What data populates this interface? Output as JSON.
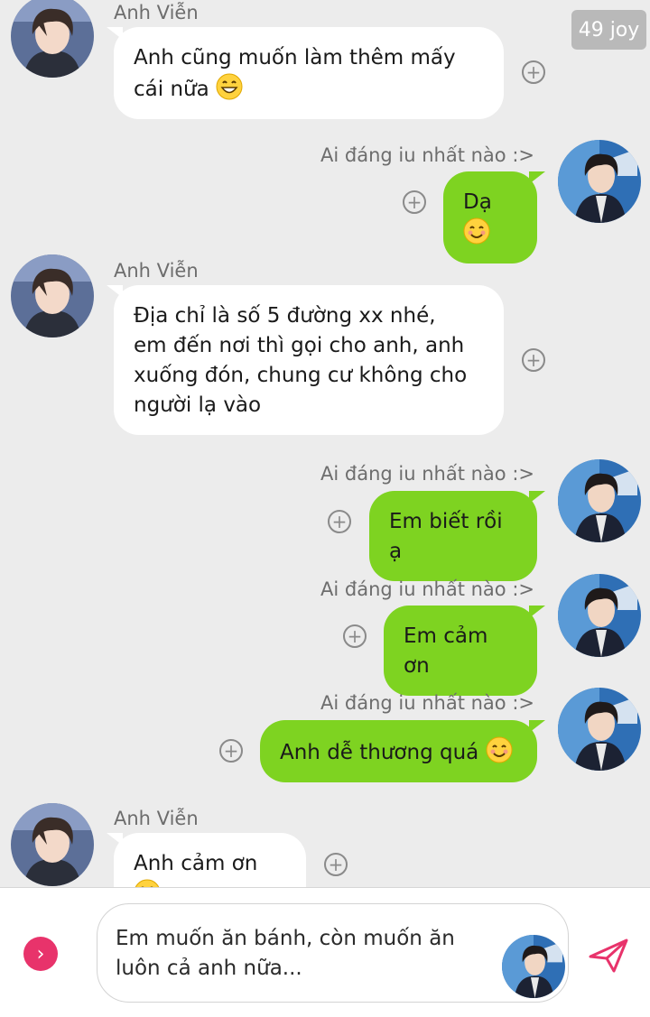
{
  "badge": "49 joy",
  "names": {
    "other": "Anh Viễn",
    "me": "Ai đáng iu nhất nào :>"
  },
  "messages": [
    {
      "from": "other",
      "lines": [
        "Anh cũng muốn làm thêm mấy",
        "cái nữa"
      ],
      "emoji": "grin"
    },
    {
      "from": "me",
      "lines": [
        "Dạ"
      ],
      "emoji": "smile"
    },
    {
      "from": "other",
      "lines": [
        "Địa chỉ là số 5 đường xx nhé,",
        "em đến nơi thì gọi cho anh, anh",
        "xuống đón, chung cư không cho",
        "người lạ vào"
      ]
    },
    {
      "from": "me",
      "lines": [
        "Em biết rồi ạ"
      ]
    },
    {
      "from": "me",
      "lines": [
        "Em cảm ơn"
      ]
    },
    {
      "from": "me",
      "lines": [
        "Anh dễ thương quá"
      ],
      "emoji": "smile"
    },
    {
      "from": "other",
      "lines": [
        "Anh cảm ơn"
      ],
      "emoji": "grin"
    }
  ],
  "composer": {
    "text_line1": "Em muốn ăn bánh, còn muốn ăn",
    "text_line2": "luôn cả anh nữa..."
  },
  "colors": {
    "outgoing_bubble": "#7ed321",
    "incoming_bubble": "#ffffff",
    "background": "#ececec",
    "send_icon": "#e8336b"
  },
  "icons": [
    "add-reaction-icon",
    "expand-icon",
    "send-icon",
    "grin-emoji-icon",
    "smile-emoji-icon"
  ]
}
